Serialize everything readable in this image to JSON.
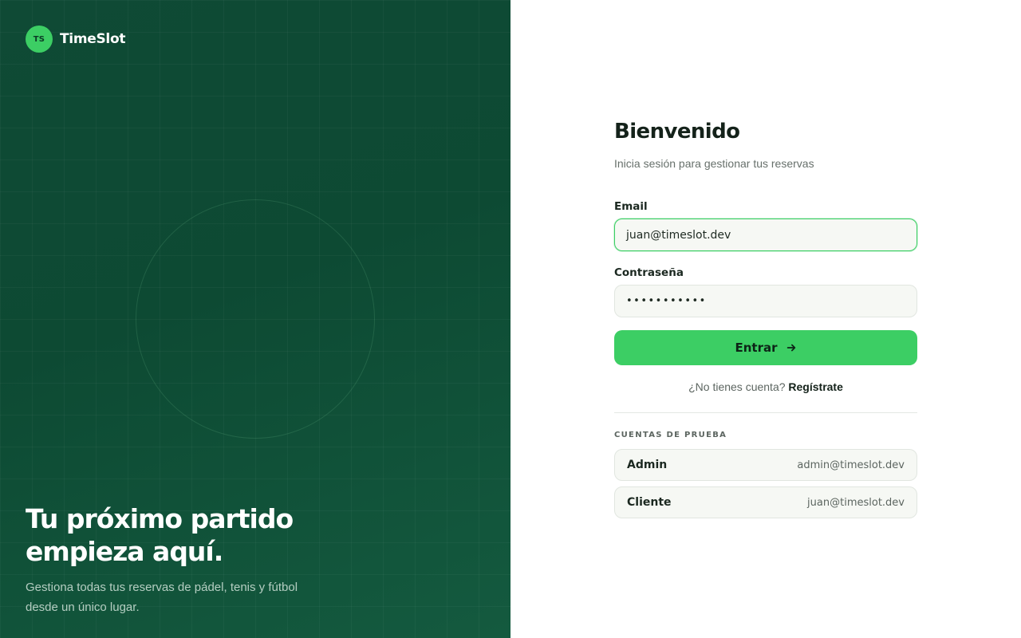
{
  "brand": {
    "logo_text": "TS",
    "name": "TimeSlot",
    "accent": "#3cce64"
  },
  "hero": {
    "title_line1": "Tu próximo partido",
    "title_line2": "empieza aquí.",
    "subtitle": "Gestiona todas tus reservas de pádel, tenis y fútbol desde un único lugar."
  },
  "login": {
    "title": "Bienvenido",
    "subtitle": "Inicia sesión para gestionar tus reservas",
    "email_label": "Email",
    "email_value": "juan@timeslot.dev",
    "password_label": "Contraseña",
    "password_value": "•••••••••••",
    "submit_label": "Entrar",
    "submit_icon": "arrow-right-icon",
    "signup_prompt": "¿No tienes cuenta?",
    "signup_link": "Regístrate"
  },
  "test_accounts": {
    "heading": "CUENTAS DE PRUEBA",
    "items": [
      {
        "role": "Admin",
        "email": "admin@timeslot.dev"
      },
      {
        "role": "Cliente",
        "email": "juan@timeslot.dev"
      }
    ]
  },
  "colors": {
    "panel_dark": "#0d4a33",
    "accent": "#3cce64",
    "text_dark": "#14221a",
    "input_bg": "#f6f8f4"
  }
}
